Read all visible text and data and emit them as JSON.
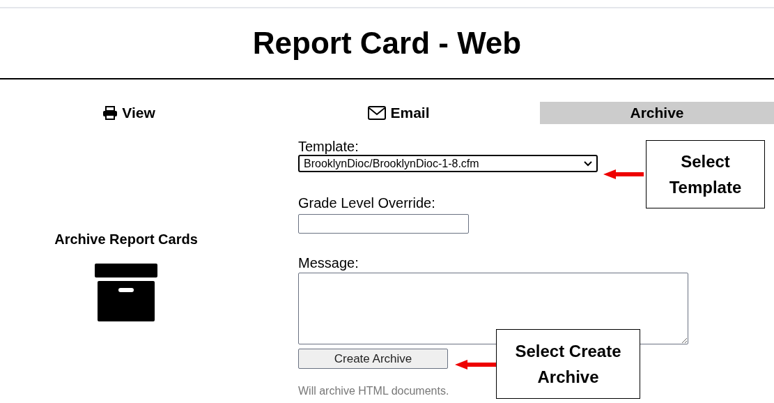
{
  "header": {
    "title": "Report Card - Web"
  },
  "tabs": [
    {
      "label": "View",
      "kind": "print",
      "selected": false
    },
    {
      "label": "Email",
      "kind": "mail",
      "selected": false
    },
    {
      "label": "Archive",
      "kind": "plain",
      "selected": true
    }
  ],
  "sidebar": {
    "heading": "Archive Report Cards"
  },
  "form": {
    "template": {
      "label": "Template:",
      "value": "BrooklynDioc/BrooklynDioc-1-8.cfm"
    },
    "grade_override": {
      "label": "Grade Level Override:"
    },
    "message": {
      "label": "Message:"
    },
    "button": "Create Archive",
    "note": "Will archive HTML documents."
  },
  "callouts": [
    {
      "text": "Select Template"
    },
    {
      "text": "Select Create Archive"
    }
  ]
}
